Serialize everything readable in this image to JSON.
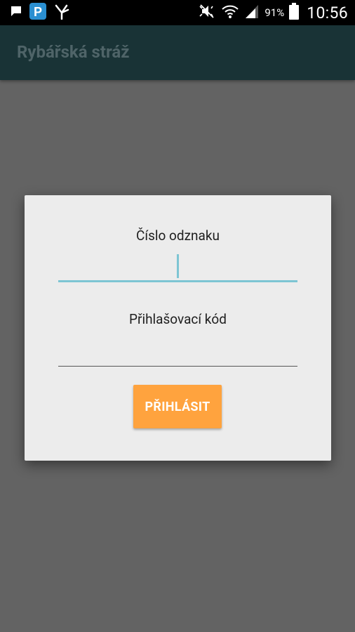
{
  "status_bar": {
    "icons_left": [
      "message-icon",
      "parking-app-icon",
      "sparkle-app-icon"
    ],
    "icons_right": [
      "mute-icon",
      "wifi-icon",
      "signal-icon",
      "battery-icon"
    ],
    "battery_percent": "91%",
    "time": "10:56"
  },
  "app_bar": {
    "title": "Rybářská stráž",
    "color": "#193336"
  },
  "dialog": {
    "badge_label": "Číslo odznaku",
    "badge_value": "",
    "code_label": "Přihlašovací kód",
    "code_value": "",
    "login_button": "PŘIHLÁSIT"
  },
  "colors": {
    "accent": "#7dc5d3",
    "button": "#ffa33e",
    "scrim": "#636363"
  }
}
